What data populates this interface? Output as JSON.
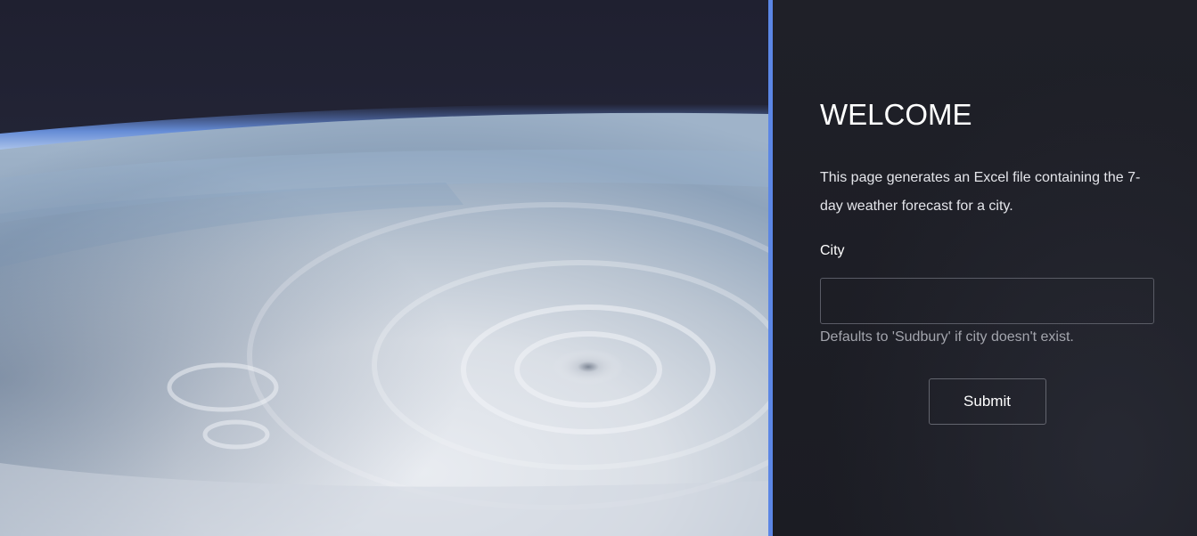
{
  "hero": {
    "image_name": "earth-from-space-hurricane-image"
  },
  "colors": {
    "accent": "#5b86e5",
    "panel_background": "#1d1e25",
    "text": "#ffffff",
    "muted_text": "#a3a5ad"
  },
  "welcome": {
    "title": "WELCOME",
    "intro": "This page generates an Excel file containing the 7-day weather forecast for a city."
  },
  "form": {
    "city_label": "City",
    "city_value": "",
    "city_help": "Defaults to 'Sudbury' if city doesn't exist.",
    "submit_label": "Submit"
  }
}
